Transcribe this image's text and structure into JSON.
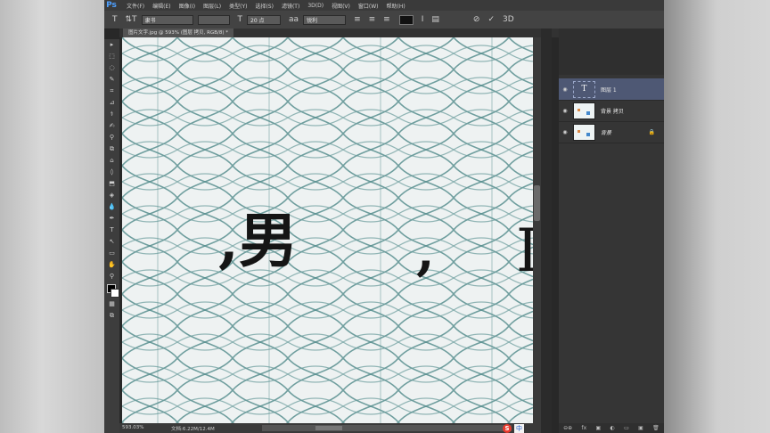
{
  "app": {
    "logo": "Ps"
  },
  "menu": [
    "文件(F)",
    "编辑(E)",
    "图像(I)",
    "图层(L)",
    "类型(Y)",
    "选择(S)",
    "滤镜(T)",
    "3D(D)",
    "视图(V)",
    "窗口(W)",
    "帮助(H)"
  ],
  "options": {
    "tool_icon": "T",
    "orient_icon": "⇅T",
    "font_family": "隶书",
    "font_style": "",
    "size_icon": "T",
    "font_size": "20 点",
    "aa_icon": "aa",
    "antialias": "锐利",
    "align_icons": [
      "≡",
      "≡",
      "≡"
    ],
    "warp_icon": "Ⅰ",
    "panel_icon": "▤",
    "cancel_icon": "⊘",
    "commit_icon": "✓",
    "threed_icon": "3D"
  },
  "document": {
    "tab": "图片文字.jpg @ 593% (图层 拷贝, RGB/8) *"
  },
  "canvas": {
    "text1": ",男",
    "text2": ",",
    "text3": "I"
  },
  "status": {
    "zoom": "593.03%",
    "doc": "文档:6.22M/12.4M"
  },
  "ime": {
    "logo": "S",
    "label": "中"
  },
  "layers": [
    {
      "name": "图层 1",
      "type": "text",
      "thumb": "T",
      "selected": true
    },
    {
      "name": "背景 拷贝",
      "type": "image",
      "selected": false
    },
    {
      "name": "背景",
      "type": "image",
      "selected": false,
      "locked": true
    }
  ],
  "layers_footer": [
    "⊖⊕",
    "fx",
    "▣",
    "◐",
    "▭",
    "▣",
    "🗑"
  ],
  "tools": [
    "▸",
    "⬚",
    "◌",
    "✎",
    "⌗",
    "⊿",
    "⚕",
    "✍",
    "⚲",
    "⧉",
    "⌂",
    "◊",
    "⬒",
    "◈",
    "💧",
    "✒",
    "T",
    "↖",
    "▭",
    "✋",
    "⚲",
    "◘",
    "▦",
    "⧉"
  ]
}
